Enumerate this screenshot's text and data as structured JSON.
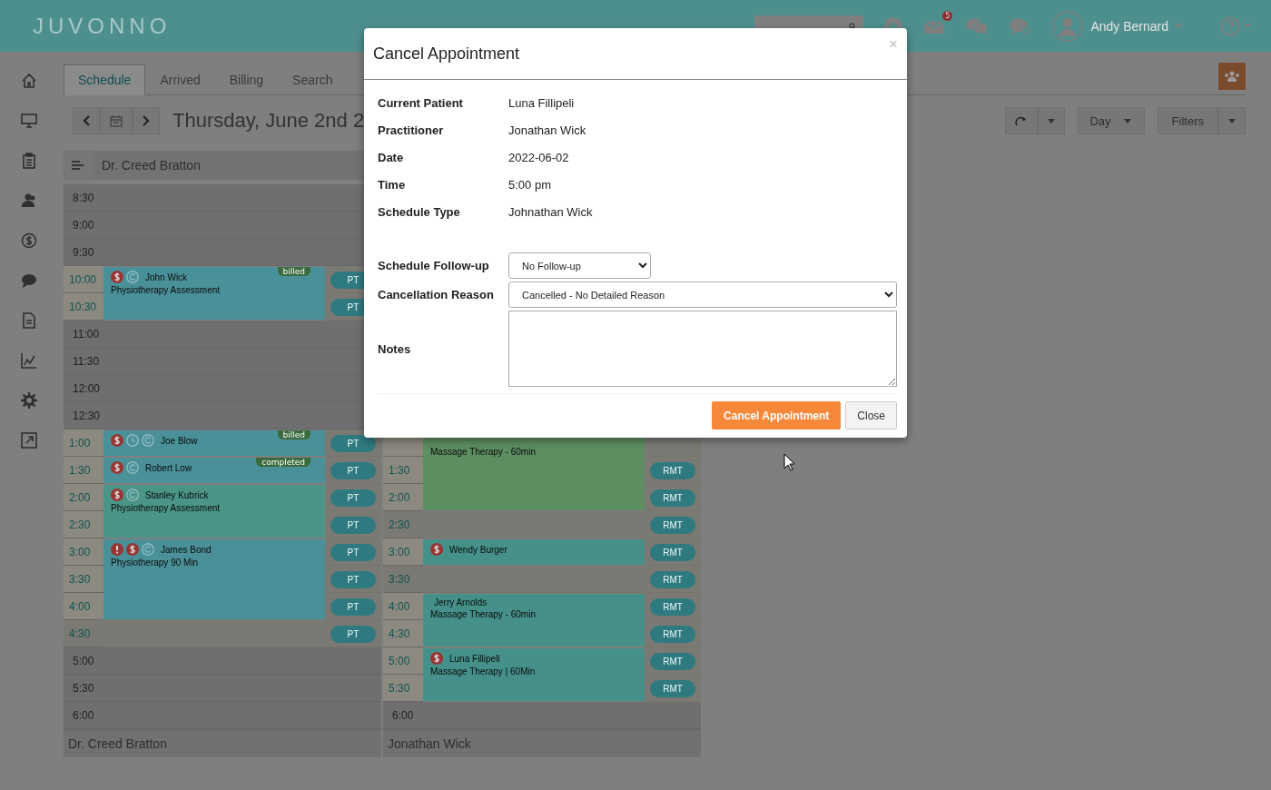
{
  "app": {
    "logo": "JUVONNO",
    "notification_count": "5",
    "user": "Andy Bernard"
  },
  "tabs": [
    {
      "label": "Schedule",
      "selected": true
    },
    {
      "label": "Arrived",
      "selected": false
    },
    {
      "label": "Billing",
      "selected": false
    },
    {
      "label": "Search",
      "selected": false
    }
  ],
  "toolbar": {
    "date_title": "Thursday, June 2nd 2",
    "view": "Day",
    "filters": "Filters"
  },
  "columns": [
    {
      "header": "Dr. Creed Bratton",
      "footer": "Dr. Creed Bratton",
      "rows": [
        {
          "time": "8:30",
          "open": false,
          "booked": false
        },
        {
          "time": "9:00",
          "open": false,
          "booked": false
        },
        {
          "time": "9:30",
          "open": false,
          "booked": false
        },
        {
          "time": "10:00",
          "open": true,
          "booked": true,
          "badge": "PT",
          "event": {
            "name": "John Wick",
            "description": "Physiotherapy Assessment",
            "tag": "billed",
            "alert": false,
            "unpaid": true,
            "clock": false,
            "recurring": true,
            "color": "#4a9099"
          }
        },
        {
          "time": "10:30",
          "open": true,
          "booked": true,
          "badge": "PT"
        },
        {
          "time": "11:00",
          "open": false,
          "booked": false
        },
        {
          "time": "11:30",
          "open": false,
          "booked": false
        },
        {
          "time": "12:00",
          "open": false,
          "booked": false
        },
        {
          "time": "12:30",
          "open": false,
          "booked": false
        },
        {
          "time": "1:00",
          "open": true,
          "booked": true,
          "badge": "PT",
          "event": {
            "name": "Joe Blow",
            "tag": "billed",
            "alert": false,
            "unpaid": true,
            "clock": true,
            "recurring": true,
            "color": "#4a9099"
          }
        },
        {
          "time": "1:30",
          "open": true,
          "booked": true,
          "badge": "PT",
          "event": {
            "name": "Robert Low",
            "tag": "completed",
            "alert": false,
            "unpaid": true,
            "clock": false,
            "recurring": true,
            "color": "#4a9099"
          }
        },
        {
          "time": "2:00",
          "open": true,
          "booked": true,
          "badge": "PT",
          "event": {
            "name": "Stanley Kubrick",
            "description": "Physiotherapy Assessment",
            "alert": false,
            "unpaid": true,
            "clock": false,
            "recurring": true,
            "color": "#4a9488"
          }
        },
        {
          "time": "2:30",
          "open": true,
          "booked": true,
          "badge": "PT"
        },
        {
          "time": "3:00",
          "open": true,
          "booked": true,
          "badge": "PT",
          "event": {
            "name": "James Bond",
            "description": "Physiotherapy 90 Min",
            "alert": true,
            "unpaid": true,
            "clock": false,
            "recurring": true,
            "color": "#4a9099"
          }
        },
        {
          "time": "3:30",
          "open": true,
          "booked": true,
          "badge": "PT"
        },
        {
          "time": "4:00",
          "open": true,
          "booked": true,
          "badge": "PT"
        },
        {
          "time": "4:30",
          "open": true,
          "booked": false,
          "badge": "PT"
        },
        {
          "time": "5:00",
          "open": false,
          "booked": false
        },
        {
          "time": "5:30",
          "open": false,
          "booked": false
        },
        {
          "time": "6:00",
          "open": false,
          "booked": false
        }
      ]
    },
    {
      "footer": "Jonathan Wick",
      "rows": [
        {
          "open": true,
          "booked": true,
          "event": {
            "description": "Massage Therapy - 60min",
            "alert": false,
            "unpaid": false,
            "clock": false,
            "recurring": false,
            "color": "#5c8e62"
          }
        },
        {
          "time": "1:30",
          "open": true,
          "booked": true,
          "badge": "RMT"
        },
        {
          "time": "2:00",
          "open": true,
          "booked": true,
          "badge": "RMT"
        },
        {
          "time": "2:30",
          "open": true,
          "booked": false,
          "badge": "RMT"
        },
        {
          "time": "3:00",
          "open": true,
          "booked": true,
          "badge": "RMT",
          "event": {
            "name": "Wendy Burger",
            "alert": false,
            "unpaid": true,
            "clock": false,
            "recurring": false,
            "color": "#45918a"
          }
        },
        {
          "time": "3:30",
          "open": true,
          "booked": false,
          "badge": "RMT"
        },
        {
          "time": "4:00",
          "open": true,
          "booked": true,
          "badge": "RMT",
          "event": {
            "name": "Jerry Arnolds",
            "description": "Massage Therapy - 60min",
            "alert": false,
            "unpaid": false,
            "clock": false,
            "recurring": false,
            "color": "#45918a"
          }
        },
        {
          "time": "4:30",
          "open": true,
          "booked": true,
          "badge": "RMT"
        },
        {
          "time": "5:00",
          "open": true,
          "booked": true,
          "badge": "RMT",
          "event": {
            "name": "Luna Fillipeli",
            "description": "Massage Therapy | 60Min",
            "alert": false,
            "unpaid": true,
            "clock": false,
            "recurring": false,
            "color": "#45918a"
          }
        },
        {
          "time": "5:30",
          "open": true,
          "booked": true,
          "badge": "RMT"
        },
        {
          "time": "6:00",
          "open": false,
          "booked": false
        }
      ]
    }
  ],
  "modal": {
    "title": "Cancel Appointment",
    "close": "×",
    "details": [
      {
        "label": "Current Patient",
        "value": "Luna Fillipeli"
      },
      {
        "label": "Practitioner",
        "value": "Jonathan Wick"
      },
      {
        "label": "Date",
        "value": "2022-06-02"
      },
      {
        "label": "Time",
        "value": "5:00 pm"
      },
      {
        "label": "Schedule Type",
        "value": "Johnathan Wick"
      }
    ],
    "follow_up": {
      "label": "Schedule Follow-up",
      "value": "No Follow-up"
    },
    "reason": {
      "label": "Cancellation Reason",
      "value": "Cancelled - No Detailed Reason"
    },
    "notes": {
      "label": "Notes"
    },
    "buttons": [
      {
        "label": "Cancel Appointment",
        "kind": "primary"
      },
      {
        "label": "Close",
        "kind": "default"
      }
    ]
  }
}
